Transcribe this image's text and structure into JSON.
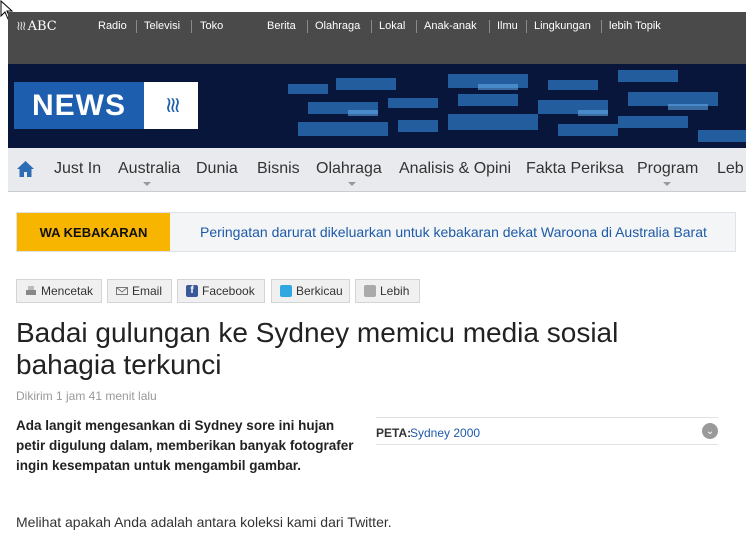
{
  "topbar": {
    "brand": "ABC",
    "left_links": [
      "Radio",
      "Televisi",
      "Toko"
    ],
    "right_links": [
      "Berita",
      "Olahraga",
      "Lokal",
      "Anak-anak",
      "Ilmu",
      "Lingkungan",
      "lebih Topik"
    ]
  },
  "banner": {
    "news_label": "NEWS"
  },
  "nav": {
    "items": [
      {
        "label": "Just In"
      },
      {
        "label": "Australia"
      },
      {
        "label": "Dunia"
      },
      {
        "label": "Bisnis"
      },
      {
        "label": "Olahraga"
      },
      {
        "label": "Analisis & Opini"
      },
      {
        "label": "Fakta Periksa"
      },
      {
        "label": "Program"
      },
      {
        "label": "Leb"
      }
    ]
  },
  "breaking": {
    "tag": "WA KEBAKARAN",
    "message": "Peringatan darurat dikeluarkan untuk kebakaran dekat Waroona di Australia Barat"
  },
  "share": {
    "print": "Mencetak",
    "email": "Email",
    "facebook": "Facebook",
    "twitter": "Berkicau",
    "more": "Lebih"
  },
  "article": {
    "title": "Badai gulungan ke Sydney memicu media sosial bahagia terkunci",
    "posted": "Dikirim 1 jam 41 menit lalu",
    "lead": "Ada langit mengesankan di Sydney sore ini hujan petir digulung dalam, memberikan banyak fotografer ingin kesempatan untuk mengambil gambar.",
    "body": "Melihat apakah Anda adalah antara koleksi kami dari Twitter.",
    "map_label": "PETA:",
    "map_value": "Sydney 2000"
  },
  "colors": {
    "breaking_tag": "#f7b500",
    "link": "#1e5aa8",
    "topbar": "#4a4a4a",
    "banner": "#07163a",
    "news_logo": "#1d5fae"
  }
}
